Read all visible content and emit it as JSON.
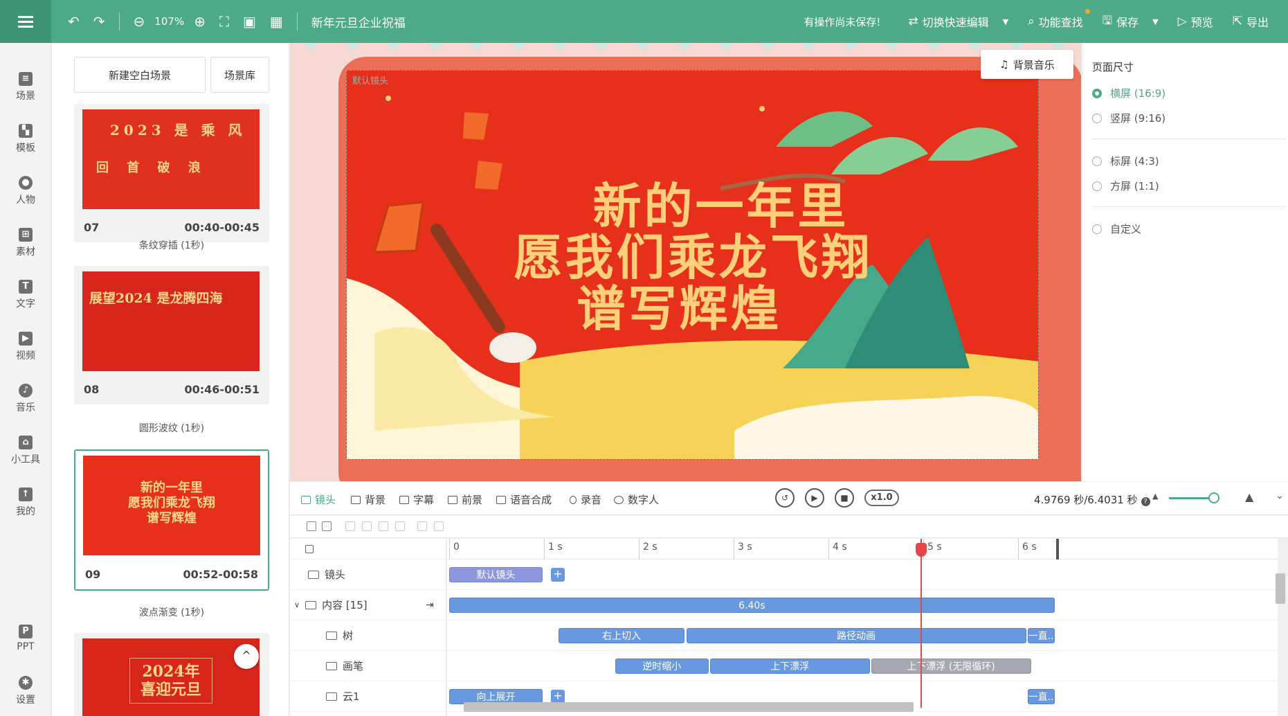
{
  "topbar": {
    "zoom": "107%",
    "project_title": "新年元旦企业祝福",
    "unsaved_notice": "有操作尚未保存!",
    "switch_edit": "切换快速编辑",
    "feature_search": "功能查找",
    "save": "保存",
    "preview": "预览",
    "export": "导出"
  },
  "rail": [
    "场景",
    "模板",
    "人物",
    "素材",
    "文字",
    "视频",
    "音乐",
    "小工具",
    "我的",
    "PPT",
    "设置"
  ],
  "scenes": {
    "new_blank": "新建空白场景",
    "library": "场景库",
    "cards": [
      {
        "num": "07",
        "time": "00:40-00:45",
        "thumb_lines": [
          "2023 是 乘 风",
          "回 首  破 浪"
        ],
        "transition": "条纹穿插 (1秒)"
      },
      {
        "num": "08",
        "time": "00:46-00:51",
        "thumb_lines": [
          "展望2024 是龙腾四海"
        ],
        "transition": "圆形波纹 (1秒)"
      },
      {
        "num": "09",
        "time": "00:52-00:58",
        "thumb_lines": [
          "新的一年里",
          "愿我们乘龙飞翔",
          "谱写辉煌"
        ],
        "transition": "波点渐变 (1秒)"
      },
      {
        "num": "",
        "time": "",
        "thumb_lines": [
          "2024年",
          "喜迎元旦"
        ],
        "transition": ""
      }
    ]
  },
  "canvas": {
    "camera_label": "默认镜头",
    "headline": [
      "新的一年里",
      "愿我们乘龙飞翔",
      "谱写辉煌"
    ],
    "bgm_button": "背景音乐"
  },
  "right_panel": {
    "title": "页面尺寸",
    "options": [
      {
        "label": "横屏 (16:9)",
        "selected": true
      },
      {
        "label": "竖屏 (9:16)",
        "selected": false
      },
      {
        "label": "标屏 (4:3)",
        "selected": false
      },
      {
        "label": "方屏 (1:1)",
        "selected": false
      },
      {
        "label": "自定义",
        "selected": false
      }
    ]
  },
  "timeline": {
    "tabs": [
      "镜头",
      "背景",
      "字幕",
      "前景",
      "语音合成",
      "录音",
      "数字人"
    ],
    "speed": "x1.0",
    "time_readout": "4.9769 秒/6.4031 秒",
    "ruler": [
      "0",
      "1 s",
      "2 s",
      "3 s",
      "4 s",
      "5 s",
      "6 s"
    ],
    "playhead_seconds": 4.9769,
    "total_seconds": 6.4031,
    "tracks": [
      {
        "label": "镜头",
        "clips": [
          {
            "text": "默认镜头",
            "start": 0,
            "end": 1.0,
            "style": "purple"
          }
        ]
      },
      {
        "label": "内容 [15]",
        "clips": [
          {
            "text": "6.40s",
            "start": 0,
            "end": 6.4,
            "style": "blue"
          }
        ]
      },
      {
        "label": "树",
        "clips": [
          {
            "text": "右上切入",
            "start": 1.15,
            "end": 2.5,
            "style": "blue"
          },
          {
            "text": "路径动画",
            "start": 2.5,
            "end": 6.1,
            "style": "blue"
          },
          {
            "text": "一直...",
            "start": 6.1,
            "end": 6.4,
            "style": "blue"
          }
        ]
      },
      {
        "label": "画笔",
        "clips": [
          {
            "text": "逆时缩小",
            "start": 1.75,
            "end": 2.75,
            "style": "blue"
          },
          {
            "text": "上下漂浮",
            "start": 2.75,
            "end": 4.45,
            "style": "blue"
          },
          {
            "text": "上下漂浮 (无限循环)",
            "start": 4.45,
            "end": 6.15,
            "style": "grey"
          }
        ]
      },
      {
        "label": "云1",
        "clips": [
          {
            "text": "向上展开",
            "start": 0,
            "end": 1.0,
            "style": "blue"
          },
          {
            "text": "一直...",
            "start": 6.1,
            "end": 6.4,
            "style": "blue"
          }
        ]
      }
    ]
  }
}
